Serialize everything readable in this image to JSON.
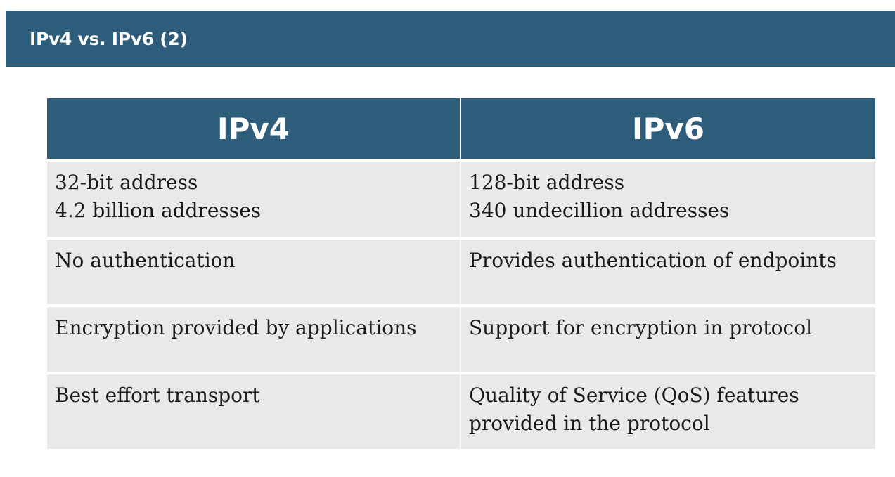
{
  "slide": {
    "title": "IPv4 vs. IPv6 (2)"
  },
  "table": {
    "headers": [
      "IPv4",
      "IPv6"
    ],
    "rows": [
      {
        "ipv4": [
          "32-bit address",
          "4.2 billion addresses"
        ],
        "ipv6": [
          "128-bit address",
          "340 undecillion addresses"
        ]
      },
      {
        "ipv4": [
          "No authentication"
        ],
        "ipv6": [
          "Provides authentication of endpoints"
        ]
      },
      {
        "ipv4": [
          "Encryption provided by applications"
        ],
        "ipv6": [
          "Support for encryption in protocol"
        ]
      },
      {
        "ipv4": [
          "Best effort transport"
        ],
        "ipv6": [
          "Quality of Service (QoS) features",
          "provided in the protocol"
        ]
      }
    ]
  },
  "colors": {
    "header_bg": "#2d5d7b",
    "cell_bg": "#e9e9e9",
    "text": "#1a1a1a"
  }
}
